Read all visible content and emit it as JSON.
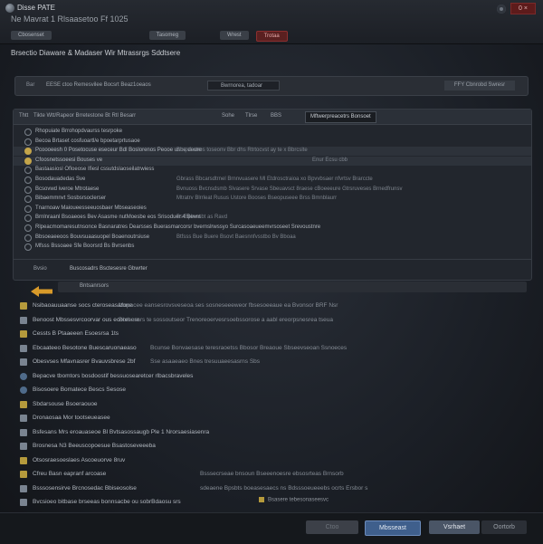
{
  "window": {
    "app_title": "Disse PATE",
    "subtitle": "Ne Mavrat 1 Rlsaasetoo Ff 1025",
    "close_label": "0 ×"
  },
  "tabs": [
    "Cbosenset",
    "Tasomeg",
    "Wrest",
    "Trotaa"
  ],
  "section_title": "Brsectio Diaware & Madaser Wir Mtrassrgs Sddtsere",
  "toolbar": {
    "label": "Bar",
    "path": "EESE ctoo Remesvilee Bocsrt Beaz1oeaos",
    "dropdown": "Bwrnorea, tadoar",
    "filter": "FFY Cbnrobd Swresr"
  },
  "panel1": {
    "header": [
      "Thtt",
      "Tikte Wtt/Rapeor Brretestone Bt Rtl Besarr",
      "Sohe",
      "Tlrse",
      "BBS"
    ],
    "header_active": "Mftwerpreacetrs Bonsoet",
    "rows": [
      {
        "text": "Rhopuiate Brrohopdvaurss tesrpoke",
        "detail": "",
        "checked": false
      },
      {
        "text": "Becoa Brtaset cosfuoartl/e bpoetarprtusaoe",
        "detail": "",
        "checked": false
      },
      {
        "text": "Pcoooeesh 0 Posetocuse eseceur Bdl Boslorenos Peooe usbe deore",
        "detail": "Bbrpvsstres toseonv Bbr dhs Rtrtocvst ay te x Bbrcslte",
        "checked": true
      },
      {
        "text": "Cfoosnetssoeesi Bouses ve",
        "detail": "Enur Ecsu cbb",
        "checked": true
      },
      {
        "text": "Bastaasiosl Ofloeose Ifiesl cssutdslaoseilatrwiess",
        "detail": "",
        "checked": false
      },
      {
        "text": "Bosodauadedas Sve",
        "detail": "Gbrass Bbcarsdtrnel Brnnvuasere Ml Etdrosctraioa xo Bpvvbsaer nfvrtsv Brarccte",
        "checked": false
      },
      {
        "text": "Bcsovwd iveroe Mtrotaese",
        "detail": "Bvnuoss Bvcnsdsmb Slvasere Srvase Sbeuavsct 8raese cBoeeeure Gtrsruveses Brnedfrunsv",
        "checked": false
      },
      {
        "text": "Bibaemmnvt Sosbsrsoclerser",
        "detail": "Mtratrv Blrrleat Rusus Ustore Booses Bseopuseee Brss Bmnblaurr",
        "checked": false
      },
      {
        "text": "Tnarnoaw Maioueesseeuosbaer Mbseaseoies",
        "detail": "",
        "checked": false
      },
      {
        "text": "Brnlnraanl Bsoaeoes Bev Asasme nutMoesbe eos Srisoduer 4 Bevnt",
        "detail": "Bs Bpbvrsbt as Ravd",
        "checked": false
      },
      {
        "text": "Rlpeacmomaresutnsonce Basnaratres Dearsses Buerasmarcorsr bvernslrwssyo Surcasoaeueemvrsoseet Srevoustnre",
        "detail": "",
        "checked": false
      },
      {
        "text": "Bbsoeaeeoos Bouvsuaasuopel Boaenoutrsiuse",
        "detail": "Btfsss Bue Buere Bsovt Baesnnfvsstbo Bv Bboaa",
        "checked": false
      },
      {
        "text": "Mfsss Bssoaee Sfe Boorsrd Bs Bvrsenbs",
        "detail": "",
        "checked": false
      }
    ],
    "footer": [
      "Bvsio",
      "Buscosadrs Bsctesesre Gbwrter"
    ]
  },
  "panel2": {
    "header": "Bntsanrsors"
  },
  "files": [
    {
      "icon": "folder",
      "name": "Nsibaoauuaanse socs cteroseasatone",
      "detail": "Mopacee eansesrovsveseoa ses sosneseeeweor fbsesoeeaue ea Bvonsor BRF Nsr"
    },
    {
      "icon": "file",
      "name": "Benoost Mbssesvrcoorvar ous ecoresere",
      "detail": "Bbrbessrs te sossoutseor Trenoreoervesrsoebssorose a aabl ereorpsnesrea tseua"
    },
    {
      "icon": "folder",
      "name": "Cessts B Ptaaeeen Esoesrsa 1ts",
      "detail": ""
    },
    {
      "icon": "file",
      "name": "Ebcaateeo Besotone Buescaruonaeaso",
      "detail": "Bcunse Bonvaesase teresraoetss Bbosor Breaoue Sbseevseoan Ssnoeces"
    },
    {
      "icon": "file",
      "name": "Obesvses Mfavnasrer Bvauvsbrese 2bf",
      "detail": "Sse asaaeaeo Bnes tresuuaeesasrns Sbs"
    },
    {
      "icon": "globe",
      "name": "Bepacve tbomtors bosdoostif bessuosearetcer rlbacsbraveles",
      "detail": ""
    },
    {
      "icon": "globe",
      "name": "Bisosoere Bomatece Bescs Sesose",
      "detail": ""
    },
    {
      "icon": "folder",
      "name": "Sbdarsouse Bsoeraouoe",
      "detail": ""
    },
    {
      "icon": "file",
      "name": "Dronaosaa Mor tootseueasee",
      "detail": ""
    },
    {
      "icon": "file",
      "name": "Bsfesans Mrs eroauaseoe Bl Bvtsasossaugb Ple 1 Nrorsaesiasenra",
      "detail": ""
    },
    {
      "icon": "file",
      "name": "Brosnesa N3 Beeuscopoesue Bsastoseveeeba",
      "detail": ""
    },
    {
      "icon": "folder",
      "name": "Otsosraesoeslaes Ascoeuorve 8ruv",
      "detail": ""
    },
    {
      "icon": "folder",
      "name": "Cfreu Basn eapranf arcoase",
      "detail": "Bsssecrseae bnsoun Bseeenoesre ebsosrteas Brnsorb"
    },
    {
      "icon": "file",
      "name": "Bsssosensirve Brcnosedac Bbiseosolse",
      "detail": "sdeaene Bpsbts boeasesaecs ns Bdsssoeueeebs ocrts Ersbor s"
    },
    {
      "icon": "file",
      "name": "Bvcsioeo bitbase brseeas bonnsacbe ou sobrBdaosu srs",
      "detail": ""
    },
    {
      "icon": "file",
      "name": "Cotbstcee Sbus roets Sreses Srer SES",
      "detail": ""
    }
  ],
  "bottom_line": "Dboaea cde lfoobse Bocsoes BBS fBI Bacsdore Sroteen Mfsouadvwo Coesemaerc euobabe ese a Bbo Dosase",
  "status": "Bsasere tebesonaseesvc",
  "footer_buttons": {
    "b1": "Ctoo",
    "b2": "Mbsseast",
    "b3": "Vsrhaet",
    "b4": "Oortorb"
  }
}
